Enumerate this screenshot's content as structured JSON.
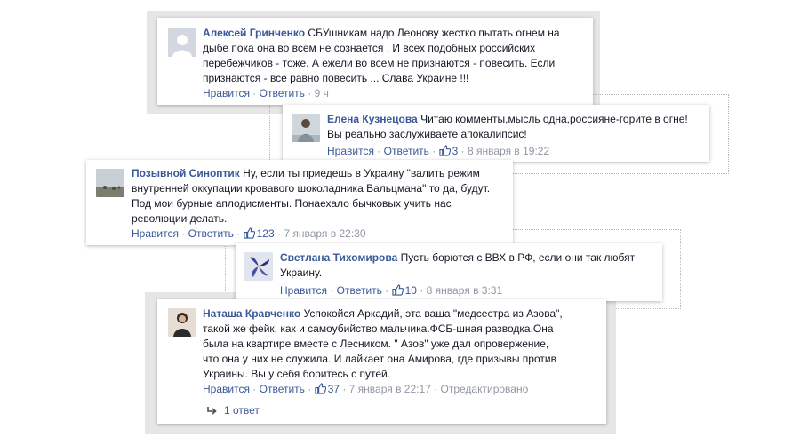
{
  "comments": [
    {
      "author": "Алексей Гринченко",
      "lines": [
        "СБУшникам надо Леонову жестко пытать огнем на",
        "дыбе пока она во всем не сознается . И всех подобных российских",
        "перебежчиков - тоже. А ежели во всем не признаются - повесить. Если",
        "признаются - все равно повесить ... Слава Украине !!!"
      ],
      "like_label": "Нравится",
      "reply_label": "Ответить",
      "time": "9 ч"
    },
    {
      "author": "Елена Кузнецова",
      "lines": [
        "Читаю комменты,мысль одна,россияне-горите в огне!",
        "Вы реально заслуживаете апокалипсис!"
      ],
      "like_label": "Нравится",
      "reply_label": "Ответить",
      "likes": "3",
      "time": "8 января в 19:22"
    },
    {
      "author": "Позывной Синоптик",
      "lines": [
        "Ну, если ты приедешь в Украину \"валить режим",
        "внутренней оккупации кровавого шоколадника Вальцмана\" то да, будут.",
        "Под мои бурные аплодисменты. Понаехало бычковых учить нас",
        "революции делать."
      ],
      "like_label": "Нравится",
      "reply_label": "Ответить",
      "likes": "123",
      "time": "7 января в 22:30"
    },
    {
      "author": "Светлана Тихомирова",
      "lines": [
        "Пусть борются с ВВХ в РФ, если они так любят",
        "Украину."
      ],
      "like_label": "Нравится",
      "reply_label": "Ответить",
      "likes": "10",
      "time": "8 января в 3:31"
    },
    {
      "author": "Наташа Кравченко",
      "lines": [
        "Успокойся Аркадий, эта ваша \"медсестра из Азова\",",
        "такой же фейк, как и самоубийство мальчика.ФСБ-шная разводка.Она",
        "была на квартире вместе с Лесником. \" Азов\" уже дал опровержение,",
        "что она у них не служила. И лайкает она Амирова, где призывы против",
        "Украины. Вы у себя боритесь с путей."
      ],
      "like_label": "Нравится",
      "reply_label": "Ответить",
      "likes": "37",
      "time": "7 января в 22:17",
      "edited": "Отредактировано",
      "replies_label": "1 ответ"
    }
  ],
  "colors": {
    "link": "#3b5998",
    "meta": "#9197a3",
    "text": "#141823"
  },
  "icons": [
    "default-avatar-icon",
    "thumbs-up-icon",
    "reply-arrow-icon"
  ]
}
